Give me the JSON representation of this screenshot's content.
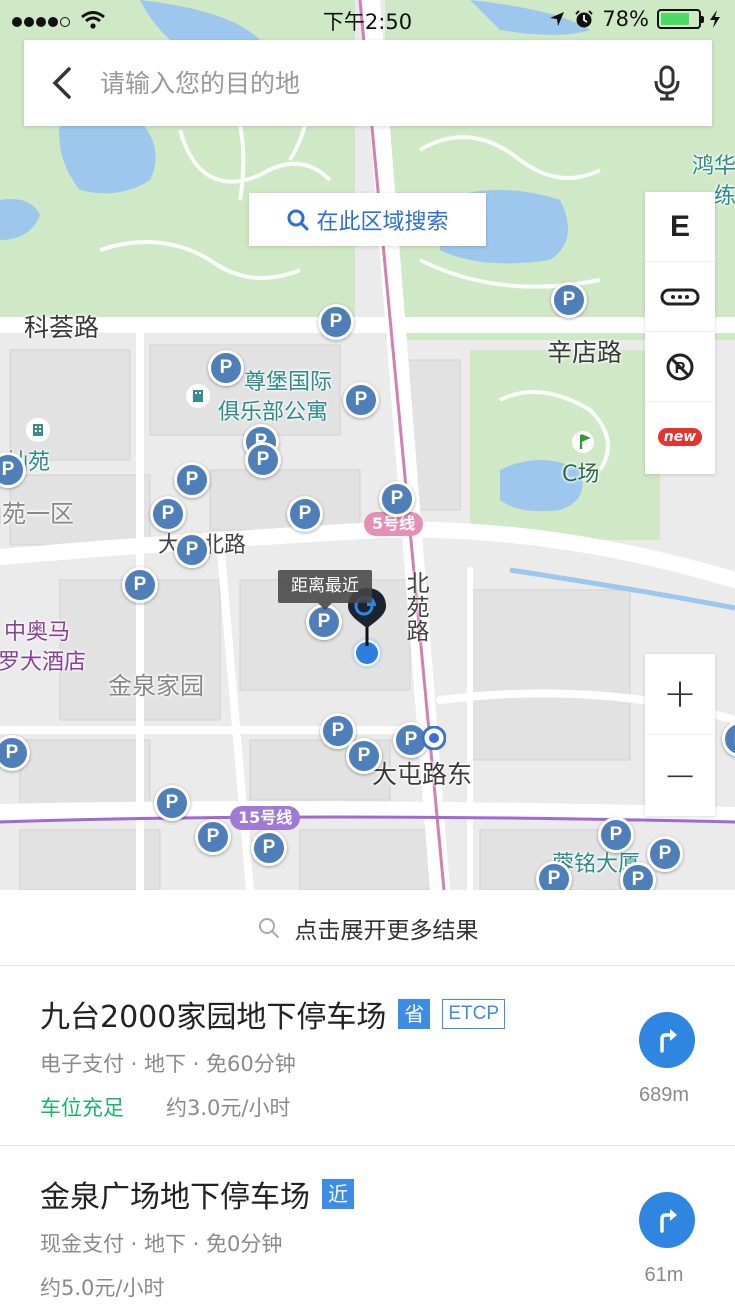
{
  "status_bar": {
    "time": "下午2:50",
    "battery": "78%",
    "battery_level": 0.78
  },
  "search": {
    "placeholder": "请输入您的目的地",
    "value": ""
  },
  "area_search": {
    "label": "在此区域搜索"
  },
  "map_tools": {
    "e_label": "E",
    "new_badge": "new"
  },
  "map": {
    "labels": {
      "kehui_road": "科荟路",
      "xindian_road": "辛店路",
      "zunbao_1": "尊堡国际",
      "zunbao_2": "俱乐部公寓",
      "canyuan": "灿苑",
      "canyuan_1": "灿苑一区",
      "datun_north": "大屯北路",
      "beiyuan_road": "北苑路",
      "olympic_1": "中奥马",
      "olympic_2": "罗大酒店",
      "jinquan_home": "金泉家园",
      "datun_east": "大屯路东",
      "c_field": "C场",
      "honghua_1": "鸿华",
      "honghua_2": "练",
      "rongming": "蓉铭大厦"
    },
    "metro": {
      "line5": "5号线",
      "line15": "15号线"
    },
    "nearest_tip": "距离最近",
    "parking_letter": "P",
    "colors": {
      "accent": "#2f86e0",
      "parking": "#4f7fb9",
      "metro5": "#e58fb6",
      "metro15": "#a07ad6",
      "green_space": "#cfe8c6"
    }
  },
  "zoom": {
    "in": "+",
    "out": "−"
  },
  "results": {
    "expand_label": "点击展开更多结果",
    "items": [
      {
        "title": "九台2000家园地下停车场",
        "tag": "省",
        "tag2": "ETCP",
        "sub": "电子支付 · 地下 · 免60分钟",
        "availability": "车位充足",
        "price": "约3.0元/小时",
        "distance": "689m"
      },
      {
        "title": "金泉广场地下停车场",
        "tag": "近",
        "sub": "现金支付 · 地下 · 免0分钟",
        "price": "约5.0元/小时",
        "distance": "61m"
      }
    ]
  }
}
